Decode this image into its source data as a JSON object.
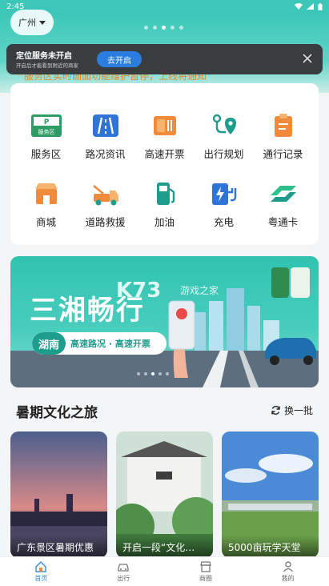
{
  "status_bar": {
    "time": "2:45"
  },
  "header": {
    "city": "广州",
    "carousel_dots": 5,
    "carousel_active": 2
  },
  "location_toast": {
    "title": "定位服务未开启",
    "subtitle": "开启后才能看到附近的商家",
    "button": "去开启"
  },
  "notice": {
    "text": "服务区实时画面功能维护暂停，上线将通知"
  },
  "services": [
    {
      "label": "服务区",
      "icon": "service-area-icon"
    },
    {
      "label": "路况资讯",
      "icon": "road-info-icon"
    },
    {
      "label": "高速开票",
      "icon": "invoice-icon"
    },
    {
      "label": "出行规划",
      "icon": "route-plan-icon"
    },
    {
      "label": "通行记录",
      "icon": "toll-record-icon"
    },
    {
      "label": "商城",
      "icon": "shop-icon"
    },
    {
      "label": "道路救援",
      "icon": "tow-truck-icon"
    },
    {
      "label": "加油",
      "icon": "fuel-pump-icon"
    },
    {
      "label": "充电",
      "icon": "ev-charge-icon"
    },
    {
      "label": "粤通卡",
      "icon": "yuetong-card-icon"
    }
  ],
  "service_icon_text": {
    "sa_badge": "P",
    "sa_label": "服务区"
  },
  "banner": {
    "title": "三湘畅行",
    "region": "湖南",
    "subtitle": "高速路况 · 高速开票",
    "watermark": "K73",
    "watermark_sub": "游戏之家",
    "dots": 5,
    "active_dot": 2
  },
  "section": {
    "title": "暑期文化之旅",
    "refresh": "换一批"
  },
  "travel_cards": [
    {
      "caption": "广东景区暑期优惠"
    },
    {
      "caption": "开启一段“文化…"
    },
    {
      "caption": "5000亩玩学天堂"
    }
  ],
  "tabbar": [
    {
      "label": "首页",
      "icon": "home-icon",
      "active": true
    },
    {
      "label": "出行",
      "icon": "car-icon",
      "active": false
    },
    {
      "label": "商圈",
      "icon": "store-icon",
      "active": false
    },
    {
      "label": "我的",
      "icon": "profile-icon",
      "active": false
    }
  ],
  "colors": {
    "brand": "#3cc7b8",
    "accent": "#2f8ee6",
    "icon_orange": "#f08a3c",
    "icon_teal": "#1e9c8c"
  }
}
